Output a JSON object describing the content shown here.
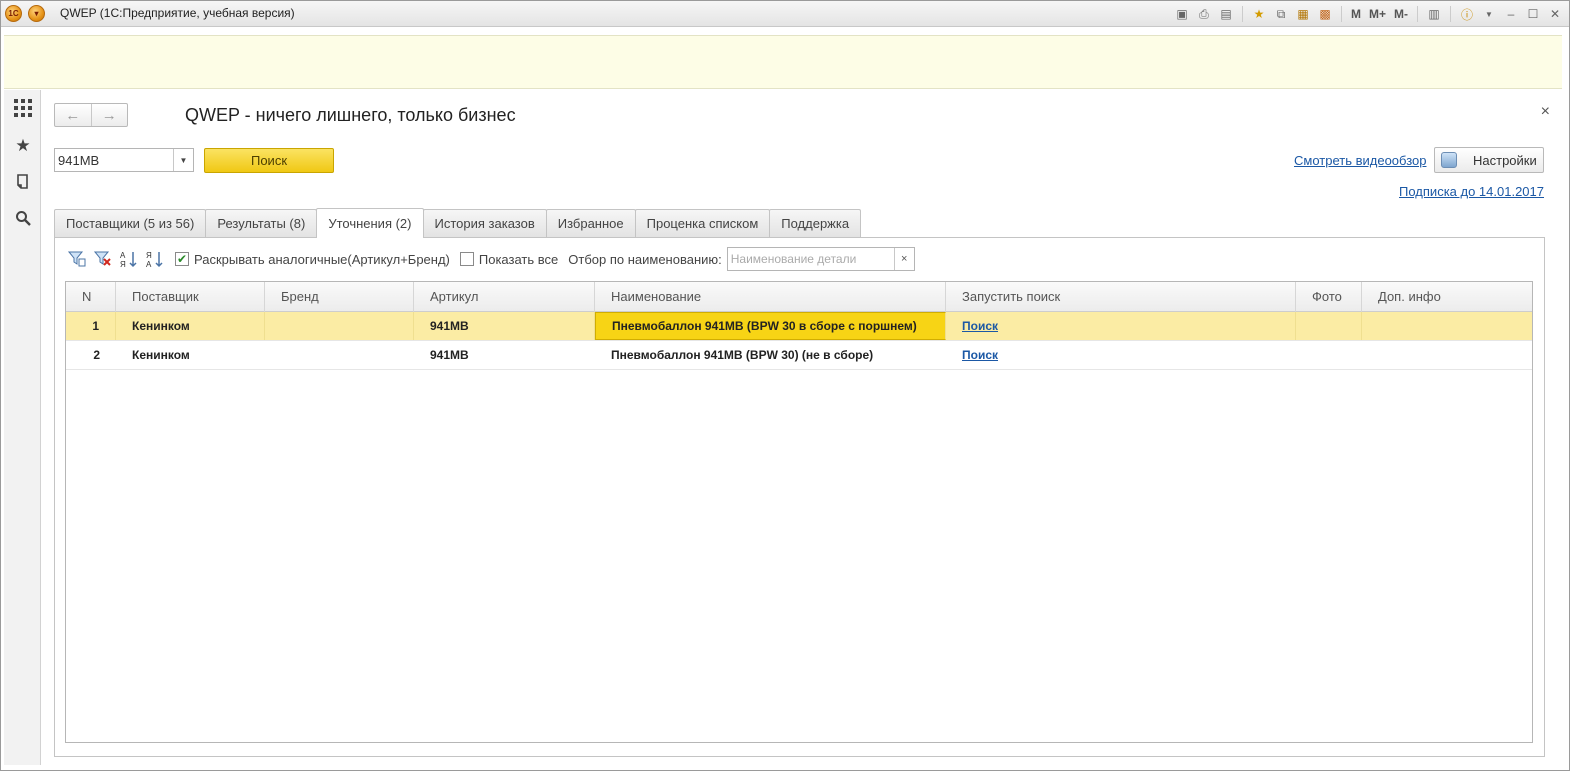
{
  "window": {
    "title": "QWEP  (1С:Предприятие, учебная версия)",
    "mem_labels": [
      "M",
      "M+",
      "M-"
    ]
  },
  "page": {
    "title": "QWEP - ничего лишнего, только бизнес"
  },
  "search": {
    "value": "941MB",
    "button_label": "Поиск"
  },
  "links": {
    "video": "Смотреть видеообзор",
    "subscription": "Подписка до 14.01.2017"
  },
  "settings": {
    "label": "Настройки"
  },
  "tabs": [
    {
      "label": "Поставщики (5 из 56)"
    },
    {
      "label": "Результаты (8)"
    },
    {
      "label": "Уточнения (2)"
    },
    {
      "label": "История заказов"
    },
    {
      "label": "Избранное"
    },
    {
      "label": "Проценка  списком"
    },
    {
      "label": "Поддержка"
    }
  ],
  "active_tab": 2,
  "toolbar": {
    "expand_analogs": {
      "label": "Раскрывать аналогичные(Артикул+Бренд)",
      "checked": true
    },
    "show_all": {
      "label": "Показать все",
      "checked": false
    },
    "filter_label": "Отбор по наименованию:",
    "filter_placeholder": "Наименование детали"
  },
  "table": {
    "columns": [
      "N",
      "Поставщик",
      "Бренд",
      "Артикул",
      "Наименование",
      "Запустить поиск",
      "Фото",
      "Доп. инфо"
    ],
    "rows": [
      {
        "n": "1",
        "supplier": "Кенинком",
        "brand": "",
        "article": "941MB",
        "name": "Пневмобаллон 941MB (BPW 30 в сборе с поршнем)",
        "action": "Поиск",
        "photo": "",
        "info": ""
      },
      {
        "n": "2",
        "supplier": "Кенинком",
        "brand": "",
        "article": "941MB",
        "name": "Пневмобаллон 941MB (BPW 30) (не в сборе)",
        "action": "Поиск",
        "photo": "",
        "info": ""
      }
    ]
  },
  "colors": {
    "accent_yellow": "#f0c814",
    "selected_row": "#fbeca4",
    "link": "#1b58a5"
  },
  "icons": [
    "apps-grid-icon",
    "star-icon",
    "history-icon",
    "search-icon",
    "back-arrow-icon",
    "forward-arrow-icon",
    "close-icon"
  ]
}
